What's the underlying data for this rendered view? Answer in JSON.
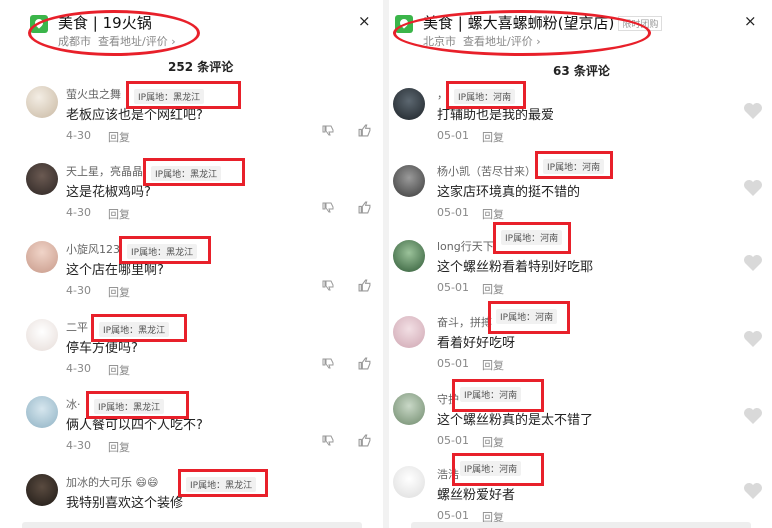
{
  "left": {
    "header": {
      "category": "美食",
      "name": "19火锅",
      "city": "成都市",
      "link": "查看地址/评价 ›"
    },
    "count": "252 条评论",
    "comments": [
      {
        "user": "萤火虫之舞",
        "text": "老板应该也是个网红吧?",
        "date": "4-30",
        "reply": "回复",
        "ip": "IP属地：黑龙江"
      },
      {
        "user": "天上星，亮晶晶",
        "text": "这是花椒鸡吗?",
        "date": "4-30",
        "reply": "回复",
        "ip": "IP属地：黑龙江"
      },
      {
        "user": "小旋风123",
        "text": "这个店在哪里啊?",
        "date": "4-30",
        "reply": "回复",
        "ip": "IP属地：黑龙江"
      },
      {
        "user": "二平",
        "text": "停车方便吗?",
        "date": "4-30",
        "reply": "回复",
        "ip": "IP属地：黑龙江"
      },
      {
        "user": "冰·",
        "text": "俩人餐可以四个人吃不?",
        "date": "4-30",
        "reply": "回复",
        "ip": "IP属地：黑龙江"
      },
      {
        "user": "加冰的大可乐 😄😄",
        "text": "我特别喜欢这个装修",
        "date": "",
        "reply": "",
        "ip": "IP属地：黑龙江"
      }
    ]
  },
  "right": {
    "header": {
      "category": "美食",
      "name": "螺大喜螺蛳粉(望京店)",
      "badge": "限时团购",
      "city": "北京市",
      "link": "查看地址/评价 ›"
    },
    "count": "63 条评论",
    "comments": [
      {
        "user": "，",
        "text": "打辅助也是我的最爱",
        "date": "05-01",
        "reply": "回复",
        "ip": "IP属地：河南"
      },
      {
        "user": "杨小凯（苦尽甘来）",
        "text": "这家店环境真的挺不错的",
        "date": "05-01",
        "reply": "回复",
        "ip": "IP属地：河南"
      },
      {
        "user": "long行天下",
        "text": "这个螺丝粉看着特别好吃耶",
        "date": "05-01",
        "reply": "回复",
        "ip": "IP属地：河南"
      },
      {
        "user": "奋斗，拼搏",
        "text": "看着好好吃呀",
        "date": "05-01",
        "reply": "回复",
        "ip": "IP属地：河南"
      },
      {
        "user": "守护",
        "text": "这个螺丝粉真的是太不错了",
        "date": "05-01",
        "reply": "回复",
        "ip": "IP属地：河南"
      },
      {
        "user": "浩浩",
        "text": "螺丝粉爱好者",
        "date": "05-01",
        "reply": "回复",
        "ip": "IP属地：河南"
      }
    ]
  },
  "icons": {
    "close": "×",
    "dislike": "thumb-down-icon",
    "like": "thumb-up-icon",
    "heart": "heart-icon",
    "store": "location-pin-icon"
  }
}
